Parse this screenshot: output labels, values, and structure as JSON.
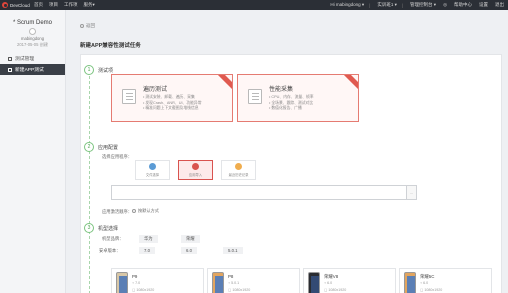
{
  "topbar": {
    "brand": "DevCloud",
    "nav": [
      "首页",
      "项目",
      "工作项",
      "服务▾"
    ],
    "user": "Hi mabingdong ▾",
    "project_select": "实训班1 ▾",
    "console": "管理控制台 ▾",
    "notice_icon": "bell-icon",
    "help": "帮助中心",
    "settings": "设置",
    "exit": "退出"
  },
  "sidebar": {
    "project_name": "* Scrum Demo",
    "owner": "mabingdong",
    "created": "2017-05-05 创建",
    "items": [
      {
        "label": "测试管理",
        "active": false
      },
      {
        "label": "新建APP测试",
        "active": true
      }
    ]
  },
  "breadcrumb": {
    "back_label": "返回"
  },
  "page_title": "新建APP兼容性测试任务",
  "steps": [
    {
      "num": "1",
      "label": "测试项"
    },
    {
      "num": "2",
      "label": "应用配置"
    },
    {
      "num": "3",
      "label": "机型选择"
    }
  ],
  "test_types": [
    {
      "title": "遍历测试",
      "lines": [
        "• 测试安装、卸载、遍历、采集",
        "• 发现Crash、ANR、UI、功能异常",
        "• 精准问题上下文截图及堆栈信息"
      ]
    },
    {
      "title": "性能采集",
      "lines": [
        "• CPU、内存、流量、帧率",
        "• 全场景、跟踪、测试对比",
        "• 数值化报告、广播"
      ]
    }
  ],
  "app_config": {
    "select_label": "选择应用程序：",
    "options": [
      {
        "label": "文件选择",
        "color": "#5b9bd5",
        "selected": false
      },
      {
        "label": "应用导入",
        "color": "#d9534f",
        "selected": true
      },
      {
        "label": "最近历史记录",
        "color": "#f0ad4e",
        "selected": false
      }
    ],
    "browse_label": "...",
    "scheme_label": "应用激活顺序：",
    "scheme_option": "按默认方式"
  },
  "device_select": {
    "brand_label": "机型品牌：",
    "brands": [
      "华为",
      "荣耀"
    ],
    "version_label": "安卓版本：",
    "versions": [
      "7.0",
      "6.0",
      "5.0.1"
    ],
    "devices": [
      {
        "name": "P9",
        "android": "7.0",
        "resolution": "1080x1920"
      },
      {
        "name": "P8",
        "android": "5.0.1",
        "resolution": "1080x1920"
      },
      {
        "name": "荣耀V8",
        "android": "6.0",
        "resolution": "1080x1920"
      },
      {
        "name": "荣耀5C",
        "android": "6.0",
        "resolution": "1080x1920"
      }
    ]
  }
}
